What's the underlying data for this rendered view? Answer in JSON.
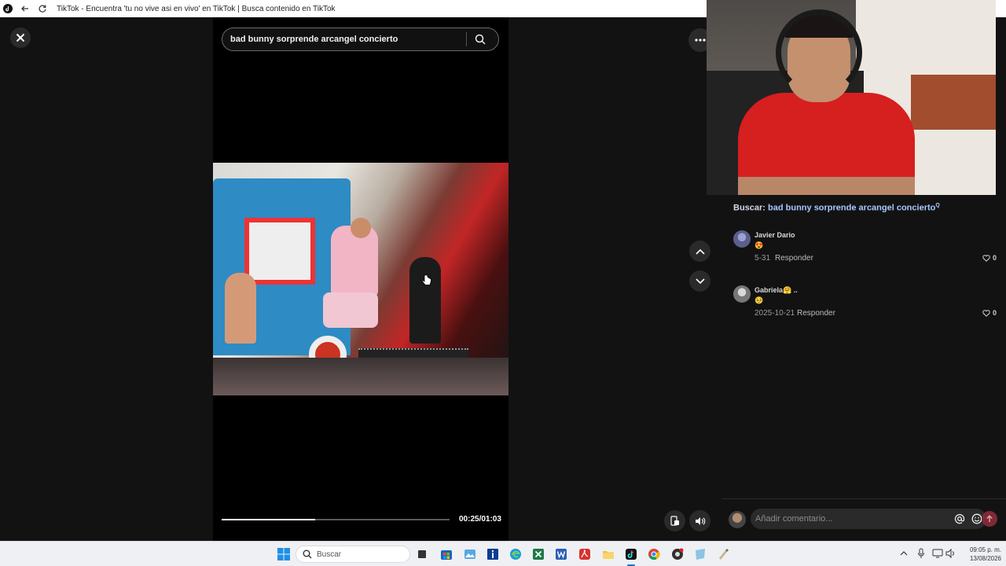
{
  "browser": {
    "title": "TikTok - Encuentra 'tu no vive asi en vivo' en TikTok | Busca contenido en TikTok"
  },
  "search": {
    "query": "bad bunny sorprende arcangel concierto"
  },
  "player": {
    "time": "00:25/01:03",
    "progress": 0.41
  },
  "sidebar": {
    "search_prefix": "Buscar:",
    "search_query": "bad bunny sorprende arcangel concierto",
    "search_mark": "Q"
  },
  "comments": [
    {
      "user": "Javier Dario",
      "emoji": "😍",
      "date": "5-31",
      "reply": "Responder",
      "likes": "0",
      "avatar_color": "#5b5f8c"
    },
    {
      "user": "Gabriela🤗 ..",
      "emoji": "🥺",
      "date": "2025-10-21",
      "reply": "Responder",
      "likes": "0",
      "avatar_color": "#9a9a9a"
    }
  ],
  "composer": {
    "placeholder": "Añadir comentario..."
  },
  "taskbar": {
    "search_label": "Buscar",
    "time": "09:05 p. m.",
    "date": "13/08/2026"
  },
  "colors": {
    "accent": "#fe2c55",
    "link": "#a8c8ff",
    "send": "#7d2a36"
  }
}
